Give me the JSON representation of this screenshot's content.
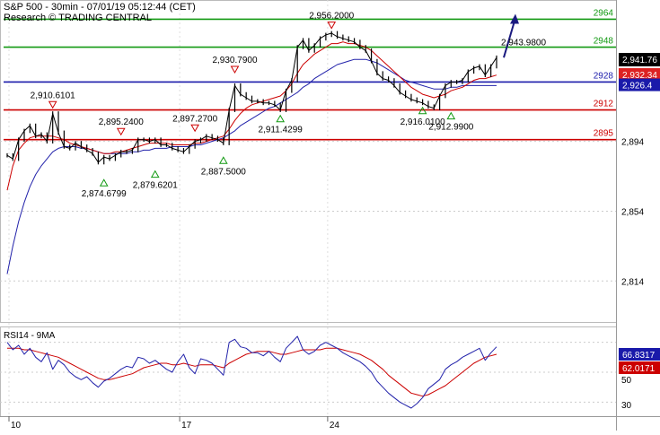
{
  "header": {
    "title": "S&P 500 - 30min - 07/01/19 05:12:44 (CET)",
    "subtitle": "Research © TRADING CENTRAL"
  },
  "rsi": {
    "label": "RSI14 - 9MA",
    "value1": "66.8317",
    "value2": "62.0171",
    "ticks": [
      "50",
      "30"
    ]
  },
  "colors": {
    "price": "#000000",
    "ma_short": "#cc0000",
    "ma_long": "#2222aa",
    "resistance": "#119911",
    "support": "#cc0000",
    "pivot": "#1a1aaa",
    "arrow": "#1a1a80"
  },
  "chart_data": [
    {
      "type": "line",
      "title": "S&P 500 - 30min - 07/01/19 05:12:44 (CET)",
      "ylim": [
        2790,
        2975
      ],
      "y_ticks": [
        2814,
        2854,
        2894
      ],
      "x_ticks": [
        "10",
        "17",
        "24"
      ],
      "current_price": "2,941.76",
      "price_labels": [
        {
          "text": "2,932.34",
          "value": 2932.34,
          "color": "#dd2222"
        },
        {
          "text": "2,926.4",
          "value": 2926.4,
          "color": "#1a1aaa"
        }
      ],
      "series": [
        {
          "style": "price",
          "values": [
            2886,
            2884,
            2895,
            2900,
            2903,
            2897,
            2898,
            2894,
            2910,
            2899,
            2891,
            2890,
            2893,
            2891,
            2889,
            2887,
            2882,
            2885,
            2884,
            2886,
            2888,
            2888,
            2889,
            2895,
            2895,
            2894,
            2895,
            2892,
            2892,
            2890,
            2889,
            2888,
            2891,
            2894,
            2895,
            2897,
            2896,
            2895,
            2893,
            2912,
            2926,
            2921,
            2919,
            2917,
            2917,
            2916,
            2916,
            2915,
            2912,
            2923,
            2929,
            2948,
            2952,
            2946,
            2949,
            2953,
            2955,
            2956,
            2954,
            2953,
            2952,
            2951,
            2948,
            2946,
            2940,
            2933,
            2930,
            2929,
            2926,
            2922,
            2920,
            2918,
            2917,
            2916,
            2914,
            2913,
            2920,
            2926,
            2928,
            2928,
            2929,
            2934,
            2936,
            2937,
            2932,
            2937,
            2942
          ]
        },
        {
          "style": "ma_short",
          "values": [
            2866,
            2880,
            2889,
            2893,
            2896,
            2897,
            2897,
            2897,
            2897,
            2896,
            2895,
            2893,
            2892,
            2891,
            2890,
            2889,
            2888,
            2887,
            2887,
            2888,
            2888,
            2889,
            2890,
            2891,
            2892,
            2893,
            2893,
            2893,
            2893,
            2892,
            2892,
            2892,
            2892,
            2893,
            2893,
            2894,
            2895,
            2896,
            2897,
            2901,
            2906,
            2910,
            2913,
            2915,
            2916,
            2917,
            2918,
            2919,
            2920,
            2923,
            2927,
            2933,
            2938,
            2941,
            2944,
            2946,
            2948,
            2950,
            2950,
            2951,
            2950,
            2950,
            2949,
            2948,
            2946,
            2943,
            2940,
            2937,
            2934,
            2931,
            2928,
            2925,
            2923,
            2921,
            2920,
            2919,
            2920,
            2921,
            2923,
            2924,
            2925,
            2927,
            2929,
            2930,
            2930,
            2931,
            2932
          ]
        },
        {
          "style": "ma_long",
          "values": [
            2818,
            2834,
            2848,
            2859,
            2868,
            2875,
            2880,
            2884,
            2888,
            2890,
            2891,
            2891,
            2891,
            2890,
            2890,
            2889,
            2888,
            2887,
            2887,
            2887,
            2887,
            2887,
            2888,
            2888,
            2889,
            2889,
            2890,
            2890,
            2890,
            2891,
            2891,
            2891,
            2891,
            2892,
            2892,
            2893,
            2894,
            2895,
            2896,
            2898,
            2900,
            2903,
            2905,
            2907,
            2909,
            2911,
            2913,
            2914,
            2916,
            2918,
            2920,
            2922,
            2925,
            2927,
            2930,
            2932,
            2934,
            2936,
            2938,
            2939,
            2940,
            2941,
            2941,
            2941,
            2940,
            2939,
            2937,
            2935,
            2933,
            2931,
            2929,
            2928,
            2927,
            2926,
            2925,
            2924,
            2924,
            2924,
            2925,
            2925,
            2926,
            2926,
            2926,
            2926,
            2926,
            2926,
            2926
          ]
        }
      ],
      "levels": [
        {
          "label": "2964",
          "value": 2964,
          "kind": "resistance"
        },
        {
          "label": "2948",
          "value": 2948,
          "kind": "resistance"
        },
        {
          "label": "2928",
          "value": 2928,
          "kind": "pivot"
        },
        {
          "label": "2912",
          "value": 2912,
          "kind": "support"
        },
        {
          "label": "2895",
          "value": 2895,
          "kind": "support"
        }
      ],
      "annotations": [
        {
          "text": "2,910.6101",
          "value": 2910.6101,
          "index": 8,
          "marker": "down"
        },
        {
          "text": "2,874.6799",
          "value": 2874.6799,
          "index": 17,
          "marker": "up"
        },
        {
          "text": "2,895.2400",
          "value": 2895.24,
          "index": 20,
          "marker": "down"
        },
        {
          "text": "2,879.6201",
          "value": 2879.6201,
          "index": 26,
          "marker": "up"
        },
        {
          "text": "2,897.2700",
          "value": 2897.27,
          "index": 33,
          "marker": "down"
        },
        {
          "text": "2,887.5000",
          "value": 2887.5,
          "index": 38,
          "marker": "up"
        },
        {
          "text": "2,930.7900",
          "value": 2930.79,
          "index": 40,
          "marker": "down"
        },
        {
          "text": "2,911.4299",
          "value": 2911.4299,
          "index": 48,
          "marker": "up"
        },
        {
          "text": "2,956.2000",
          "value": 2956.2,
          "index": 57,
          "marker": "down"
        },
        {
          "text": "2,916.0100",
          "value": 2916.01,
          "index": 73,
          "marker": "up"
        },
        {
          "text": "2,912.9900",
          "value": 2912.99,
          "index": 78,
          "marker": "up"
        },
        {
          "text": "2,943.9800",
          "value": 2943.98,
          "index": 86,
          "marker": "none"
        }
      ]
    },
    {
      "type": "line",
      "title": "RSI14 - 9MA",
      "ylim": [
        20,
        80
      ],
      "y_ticks": [
        50,
        30
      ],
      "series": [
        {
          "style": "rsi",
          "values": [
            70,
            65,
            68,
            62,
            66,
            60,
            57,
            63,
            52,
            58,
            55,
            50,
            47,
            45,
            47,
            43,
            40,
            44,
            46,
            49,
            52,
            54,
            53,
            60,
            59,
            56,
            58,
            55,
            52,
            50,
            57,
            62,
            53,
            49,
            59,
            58,
            56,
            52,
            48,
            70,
            72,
            67,
            66,
            63,
            63,
            61,
            64,
            60,
            57,
            66,
            70,
            74,
            65,
            62,
            64,
            68,
            70,
            68,
            66,
            63,
            61,
            59,
            57,
            54,
            50,
            44,
            40,
            36,
            33,
            30,
            28,
            26,
            29,
            33,
            39,
            42,
            45,
            52,
            55,
            57,
            60,
            62,
            64,
            66,
            58,
            63,
            67
          ]
        },
        {
          "style": "rsi_ma",
          "values": [
            66,
            66,
            66,
            65,
            65,
            64,
            63,
            62,
            61,
            60,
            58,
            56,
            54,
            52,
            50,
            48,
            46,
            45,
            45,
            46,
            47,
            48,
            49,
            51,
            53,
            54,
            55,
            56,
            56,
            55,
            55,
            56,
            55,
            54,
            55,
            55,
            55,
            54,
            53,
            56,
            58,
            60,
            62,
            63,
            64,
            64,
            64,
            63,
            62,
            62,
            63,
            64,
            65,
            65,
            65,
            65,
            66,
            66,
            66,
            65,
            64,
            63,
            62,
            60,
            58,
            55,
            52,
            48,
            45,
            42,
            39,
            36,
            35,
            34,
            35,
            37,
            39,
            41,
            44,
            47,
            50,
            53,
            56,
            58,
            60,
            61,
            62
          ]
        }
      ]
    }
  ]
}
